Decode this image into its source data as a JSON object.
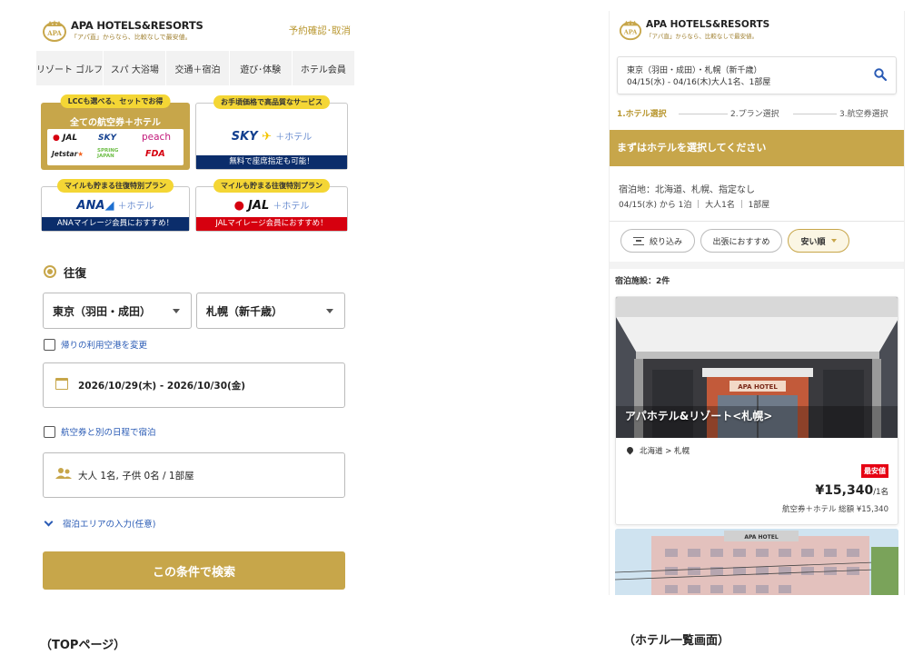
{
  "top_page": {
    "brand": {
      "name": "APA HOTELS&RESORTS",
      "tagline": "「アパ直」からなら、比較なしで最安値。"
    },
    "reserve_link": "予約確認･取消",
    "nav_tabs": [
      "リゾート ゴルフ",
      "スパ 大浴場",
      "交通＋宿泊",
      "遊び･体験",
      "ホテル会員"
    ],
    "banners": {
      "lcc": {
        "bubble": "LCCも選べる、セットでお得",
        "title": "全ての航空券＋ホテル",
        "airlines": [
          "JAL",
          "SKY",
          "peach",
          "Jetstar",
          "SPRING JAPAN",
          "FDA"
        ]
      },
      "sky": {
        "bubble": "お手頃価格で高品質なサービス",
        "logo": "SKY",
        "plus": "＋ホテル",
        "bar": "無料で座席指定も可能！"
      },
      "ana": {
        "bubble": "マイルも貯まる往復特別プラン",
        "logo": "ANA",
        "plus": "＋ホテル",
        "bar": "ANAマイレージ会員におすすめ！"
      },
      "jal": {
        "bubble": "マイルも貯まる往復特別プラン",
        "logo": "JAL",
        "plus": "＋ホテル",
        "bar": "JALマイレージ会員におすすめ！"
      }
    },
    "trip_type": "往復",
    "from_airport": "東京（羽田・成田）",
    "to_airport": "札幌（新千歳）",
    "change_return_airport": "帰りの利用空港を変更",
    "dates": "2026/10/29(木) - 2026/10/30(金)",
    "separate_stay": "航空券と別の日程で宿泊",
    "guests": "大人 1名, 子供 0名 / 1部屋",
    "stay_area": "宿泊エリアの入力(任意)",
    "search_button": "この条件で検索",
    "caption": "（TOPページ）"
  },
  "list_page": {
    "brand": {
      "name": "APA HOTELS&RESORTS",
      "tagline": "「アパ直」からなら、比較なしで最安値。"
    },
    "search_summary_line1": "東京（羽田・成田）・札幌（新千歳）",
    "search_summary_line2": "04/15(水) - 04/16(木)大人1名、1部屋",
    "steps": [
      "1.ホテル選択",
      "2.プラン選択",
      "3.航空券選択"
    ],
    "title": "まずはホテルを選択してください",
    "condition_line1": "宿泊地：北海道、札幌、指定なし",
    "condition_line2": "04/15(水) から 1泊 ｜ 大人1名 ｜ 1部屋",
    "filters": {
      "narrow": "絞り込み",
      "business": "出張におすすめ",
      "cheap": "安い順"
    },
    "facility_count": "宿泊施設：2件",
    "hotels": [
      {
        "name": "アパホテル&リゾート<札幌>",
        "location": "北海道 > 札幌",
        "badge": "最安値",
        "price": "¥15,340",
        "price_unit": "/1名",
        "total": "航空券＋ホテル 総額 ¥15,340",
        "sign_text": "APA HOTEL"
      },
      {
        "sign_text": "APA HOTEL"
      }
    ],
    "caption": "（ホテル一覧画面）"
  },
  "colors": {
    "gold": "#c7a64a",
    "navy": "#0b2d6b",
    "red": "#d6000f",
    "link_blue": "#2a5bb5"
  }
}
